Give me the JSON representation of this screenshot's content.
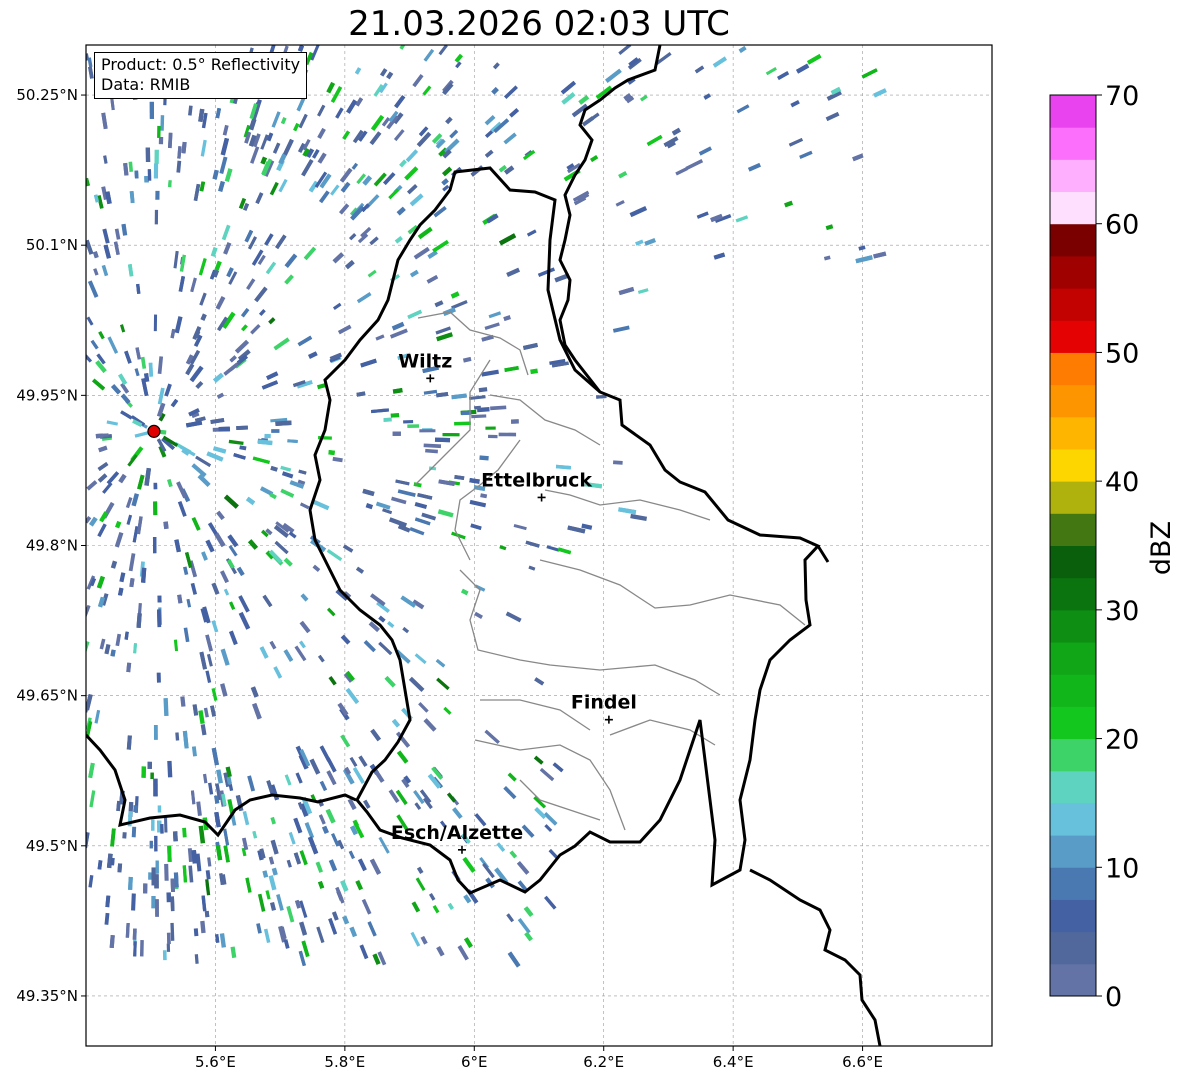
{
  "title": "21.03.2026 02:03 UTC",
  "info": {
    "product": "Product: 0.5° Reflectivity",
    "data": "Data: RMIB"
  },
  "map": {
    "extent": {
      "lon": [
        5.4,
        6.8
      ],
      "lat": [
        49.3,
        50.3
      ]
    },
    "lon_ticks": [
      {
        "v": 5.6,
        "label": "5.6°E"
      },
      {
        "v": 5.8,
        "label": "5.8°E"
      },
      {
        "v": 6.0,
        "label": "6°E"
      },
      {
        "v": 6.2,
        "label": "6.2°E"
      },
      {
        "v": 6.4,
        "label": "6.4°E"
      },
      {
        "v": 6.6,
        "label": "6.6°E"
      }
    ],
    "lat_ticks": [
      {
        "v": 50.25,
        "label": "50.25°N"
      },
      {
        "v": 50.1,
        "label": "50.1°N"
      },
      {
        "v": 49.95,
        "label": "49.95°N"
      },
      {
        "v": 49.8,
        "label": "49.8°N"
      },
      {
        "v": 49.65,
        "label": "49.65°N"
      },
      {
        "v": 49.5,
        "label": "49.5°N"
      },
      {
        "v": 49.35,
        "label": "49.35°N"
      }
    ],
    "radar_site": {
      "lon": 5.505,
      "lat": 49.914
    },
    "cities": [
      {
        "name": "Wiltz",
        "lon": 5.932,
        "lat": 49.967
      },
      {
        "name": "Ettelbruck",
        "lon": 6.104,
        "lat": 49.848
      },
      {
        "name": "Findel",
        "lon": 6.208,
        "lat": 49.626
      },
      {
        "name": "Esch/Alzette",
        "lon": 5.981,
        "lat": 49.496
      }
    ]
  },
  "colorbar": {
    "title": "dBZ",
    "min": 0,
    "max": 70,
    "step": 2.5,
    "tick_labels": [
      {
        "v": 0,
        "label": "0"
      },
      {
        "v": 10,
        "label": "10"
      },
      {
        "v": 20,
        "label": "20"
      },
      {
        "v": 30,
        "label": "30"
      },
      {
        "v": 40,
        "label": "40"
      },
      {
        "v": 50,
        "label": "50"
      },
      {
        "v": 60,
        "label": "60"
      },
      {
        "v": 70,
        "label": "70"
      }
    ],
    "colors": [
      "#6473a6",
      "#51689c",
      "#4461a3",
      "#4a78b0",
      "#589cc7",
      "#67c0dc",
      "#5dd3c0",
      "#3dd369",
      "#13c71f",
      "#10b61a",
      "#10a617",
      "#0e8e13",
      "#0b740f",
      "#095f0b",
      "#437711",
      "#afb10c",
      "#fdd600",
      "#fdb500",
      "#fd9500",
      "#fd7c01",
      "#e40202",
      "#c20101",
      "#9f0101",
      "#7a0000",
      "#fedffe",
      "#feb0fe",
      "#fc6ffc",
      "#e942ef"
    ]
  }
}
